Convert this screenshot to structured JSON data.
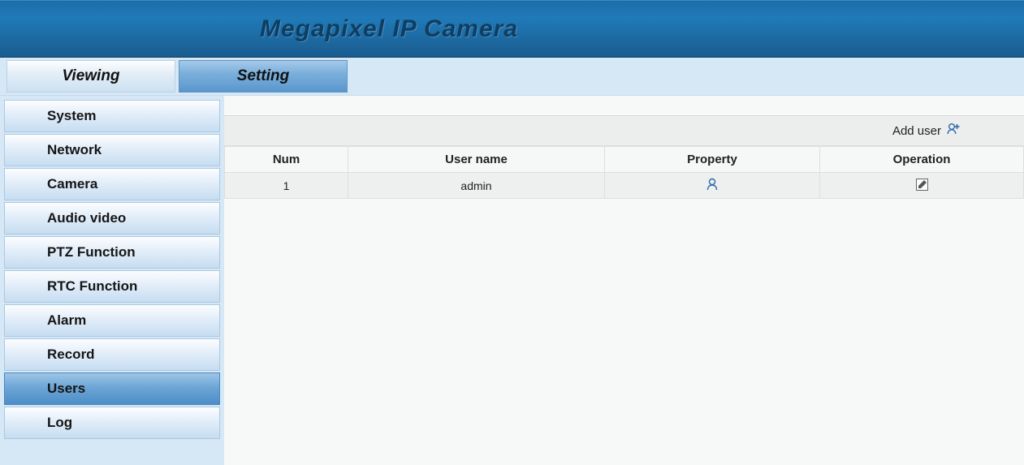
{
  "header": {
    "title": "Megapixel IP Camera"
  },
  "tabs": {
    "viewing": "Viewing",
    "setting": "Setting"
  },
  "sidebar": {
    "items": [
      {
        "label": "System"
      },
      {
        "label": "Network"
      },
      {
        "label": "Camera"
      },
      {
        "label": "Audio video"
      },
      {
        "label": "PTZ Function"
      },
      {
        "label": "RTC Function"
      },
      {
        "label": "Alarm"
      },
      {
        "label": "Record"
      },
      {
        "label": "Users"
      },
      {
        "label": "Log"
      }
    ]
  },
  "content": {
    "add_user_label": "Add user",
    "columns": {
      "num": "Num",
      "username": "User name",
      "property": "Property",
      "operation": "Operation"
    },
    "rows": [
      {
        "num": "1",
        "username": "admin"
      }
    ]
  }
}
